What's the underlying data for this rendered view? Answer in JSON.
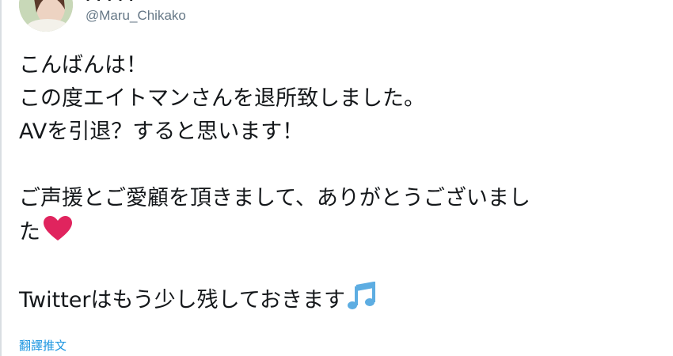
{
  "tweet": {
    "display_name": "· · · · ·",
    "handle": "@Maru_Chikako",
    "lines": [
      "こんばんは！",
      "この度エイトマンさんを退所致しました。",
      "AVを引退？すると思います！",
      "",
      "ご声援とご愛顧を頂きまして、ありがとうございまし",
      "た",
      "",
      "Twitterはもう少し残しておきます"
    ],
    "translate_label": "翻譯推文"
  },
  "icons": {
    "heart": "red-heart-emoji",
    "music": "musical-notes-emoji"
  },
  "colors": {
    "text": "#14171a",
    "handle": "#657786",
    "link": "#1b95e0",
    "heart": "#e0245e",
    "music": "#5dade2"
  }
}
